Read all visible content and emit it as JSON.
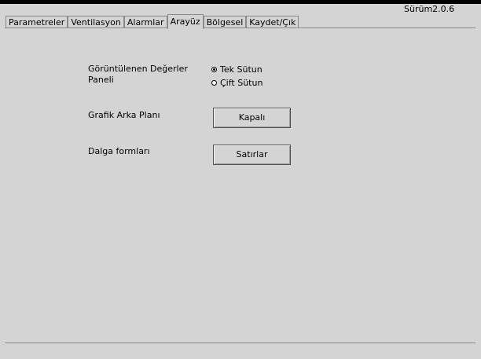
{
  "version": "Sürüm2.0.6",
  "tabs": [
    {
      "label": "Parametreler",
      "active": false
    },
    {
      "label": "Ventilasyon",
      "active": false
    },
    {
      "label": "Alarmlar",
      "active": false
    },
    {
      "label": "Arayüz",
      "active": true
    },
    {
      "label": "Bölgesel",
      "active": false
    },
    {
      "label": "Kaydet/Çık",
      "active": false
    }
  ],
  "settings": {
    "display_panel": {
      "label_line1": "Görüntülenen Değerler",
      "label_line2": "Paneli",
      "options": [
        {
          "label": "Tek Sütun",
          "selected": true
        },
        {
          "label": "Çift Sütun",
          "selected": false
        }
      ]
    },
    "graph_background": {
      "label": "Grafik Arka Planı",
      "button": "Kapalı"
    },
    "waveforms": {
      "label": "Dalga formları",
      "button": "Satırlar"
    }
  }
}
